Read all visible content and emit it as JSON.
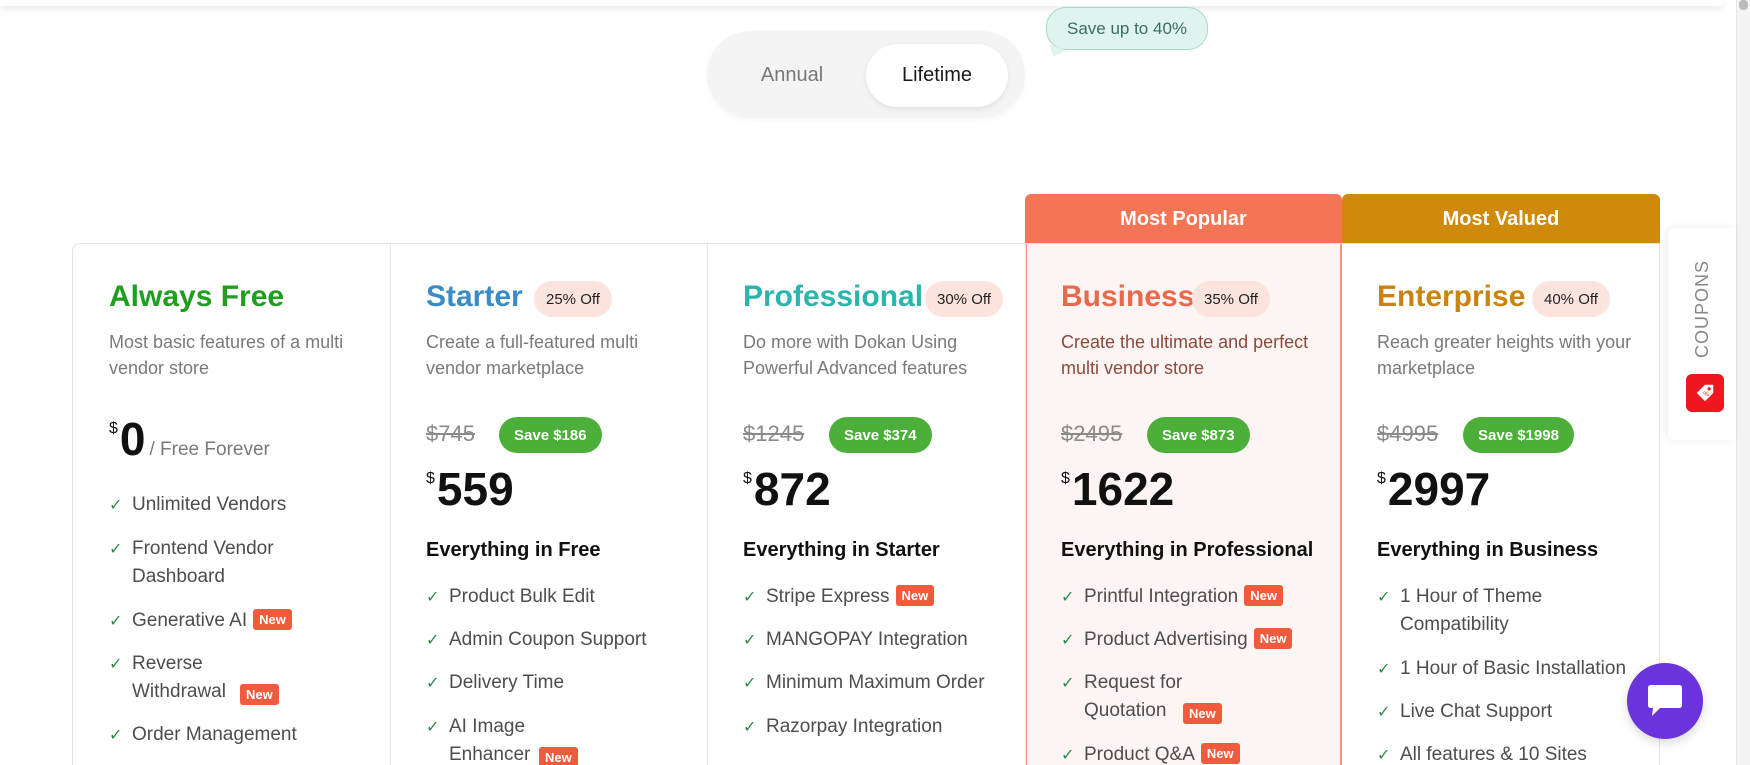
{
  "toggle": {
    "annual_label": "Annual",
    "lifetime_label": "Lifetime",
    "selected": "Lifetime",
    "save_bubble": "Save up to 40%"
  },
  "ribbons": {
    "popular": "Most Popular",
    "valued": "Most Valued"
  },
  "colors": {
    "free": "#1f9e1f",
    "starter": "#3b8cc4",
    "professional": "#2bb5ad",
    "business": "#e9694c",
    "enterprise": "#c98410",
    "save_pill": "#4caf3a",
    "new_tag": "#f05a3d",
    "popular_ribbon": "#f37555",
    "valued_ribbon": "#cf8a0a",
    "chat": "#6a33db"
  },
  "plans": [
    {
      "name": "Always Free",
      "description": "Most basic features of a multi vendor store",
      "currency": "$",
      "price": "0",
      "price_suffix": "/ Free Forever",
      "features": [
        {
          "text": "Unlimited Vendors",
          "new": false
        },
        {
          "text": "Frontend Vendor Dashboard",
          "new": false
        },
        {
          "text": "Generative AI",
          "new": true
        },
        {
          "text": "Reverse Withdrawal",
          "new": true
        },
        {
          "text": "Order Management",
          "new": false
        }
      ]
    },
    {
      "name": "Starter",
      "discount": "25% Off",
      "description": "Create a full-featured multi vendor marketplace",
      "old_price": "$745",
      "save": "Save $186",
      "currency": "$",
      "price": "559",
      "everything": "Everything in Free",
      "features": [
        {
          "text": "Product Bulk Edit",
          "new": false
        },
        {
          "text": "Admin Coupon Support",
          "new": false
        },
        {
          "text": "Delivery Time",
          "new": false
        },
        {
          "text": "AI Image Enhancer",
          "new": true
        }
      ]
    },
    {
      "name": "Professional",
      "discount": "30% Off",
      "description": "Do more with Dokan Using Powerful Advanced features",
      "old_price": "$1245",
      "save": "Save $374",
      "currency": "$",
      "price": "872",
      "everything": "Everything in Starter",
      "features": [
        {
          "text": "Stripe Express",
          "new": true
        },
        {
          "text": "MANGOPAY Integration",
          "new": false
        },
        {
          "text": "Minimum Maximum Order",
          "new": false
        },
        {
          "text": "Razorpay Integration",
          "new": false
        }
      ]
    },
    {
      "name": "Business",
      "discount": "35% Off",
      "description": "Create the ultimate and perfect multi vendor store",
      "old_price": "$2495",
      "save": "Save $873",
      "currency": "$",
      "price": "1622",
      "everything": "Everything in Professional",
      "features": [
        {
          "text": "Printful Integration",
          "new": true
        },
        {
          "text": "Product Advertising",
          "new": true
        },
        {
          "text": "Request for Quotation",
          "new": true
        },
        {
          "text": "Product Q&A",
          "new": true
        }
      ]
    },
    {
      "name": "Enterprise",
      "discount": "40% Off",
      "description": "Reach greater heights with your marketplace",
      "old_price": "$4995",
      "save": "Save $1998",
      "currency": "$",
      "price": "2997",
      "everything": "Everything in Business",
      "features": [
        {
          "text": "1 Hour of Theme Compatibility",
          "new": false
        },
        {
          "text": "1 Hour of Basic Installation",
          "new": false
        },
        {
          "text": "Live Chat Support",
          "new": false
        },
        {
          "text": "All features & 10 Sites",
          "new": false
        }
      ]
    }
  ],
  "new_label": "New",
  "coupons": {
    "label": "COUPONS",
    "icon": "coupon-tag-icon"
  },
  "chat": {
    "icon": "chat-bubble-icon"
  }
}
